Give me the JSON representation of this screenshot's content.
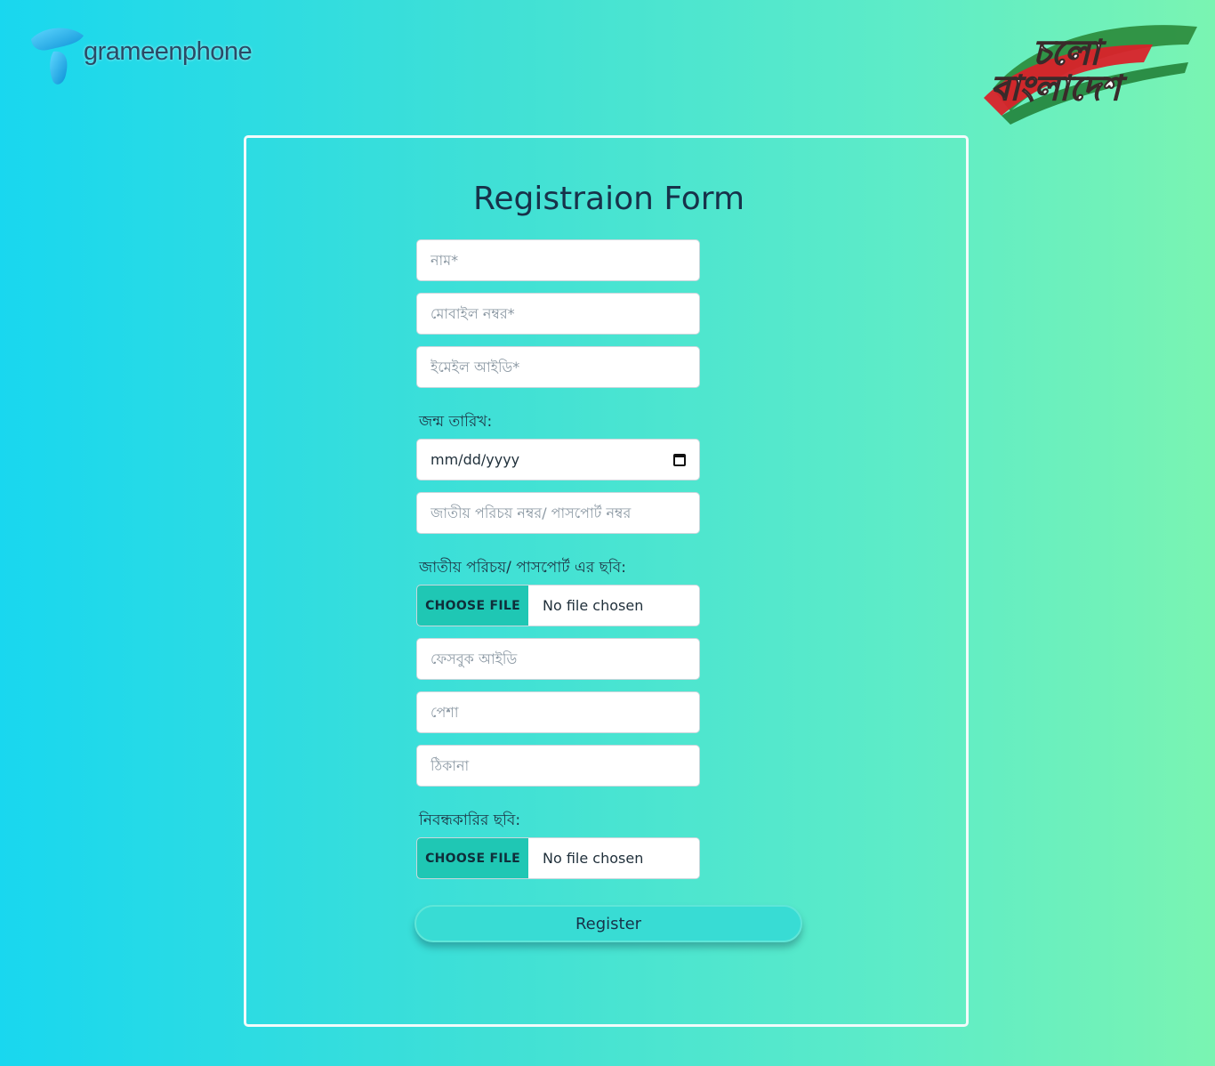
{
  "header": {
    "brand_name": "grameenphone",
    "campaign_logo_text": "চলো বাংলাদেশ"
  },
  "form": {
    "title": "Registraion Form",
    "name_placeholder": "নাম*",
    "mobile_placeholder": "মোবাইল নম্বর*",
    "email_placeholder": "ইমেইল আইডি*",
    "dob_label": "জন্ম তারিখ:",
    "dob_value": "mm/dd/yyyy",
    "nid_placeholder": "জাতীয় পরিচয় নম্বর/ পাসপোর্ট নম্বর",
    "nid_photo_label": "জাতীয় পরিচয়/ পাসপোর্ট এর ছবি:",
    "choose_file_label": "CHOOSE FILE",
    "no_file_text": "No file chosen",
    "facebook_placeholder": "ফেসবুক আইডি",
    "profession_placeholder": "পেশা",
    "address_placeholder": "ঠিকানা",
    "registrant_photo_label": "নিবন্ধকারির ছবি:",
    "register_label": "Register"
  },
  "colors": {
    "gradient_start": "#19d7ef",
    "gradient_end": "#7af4b2",
    "file_button": "#1fc7b4",
    "register_button": "#38dcd4",
    "title_text": "#17324a"
  }
}
